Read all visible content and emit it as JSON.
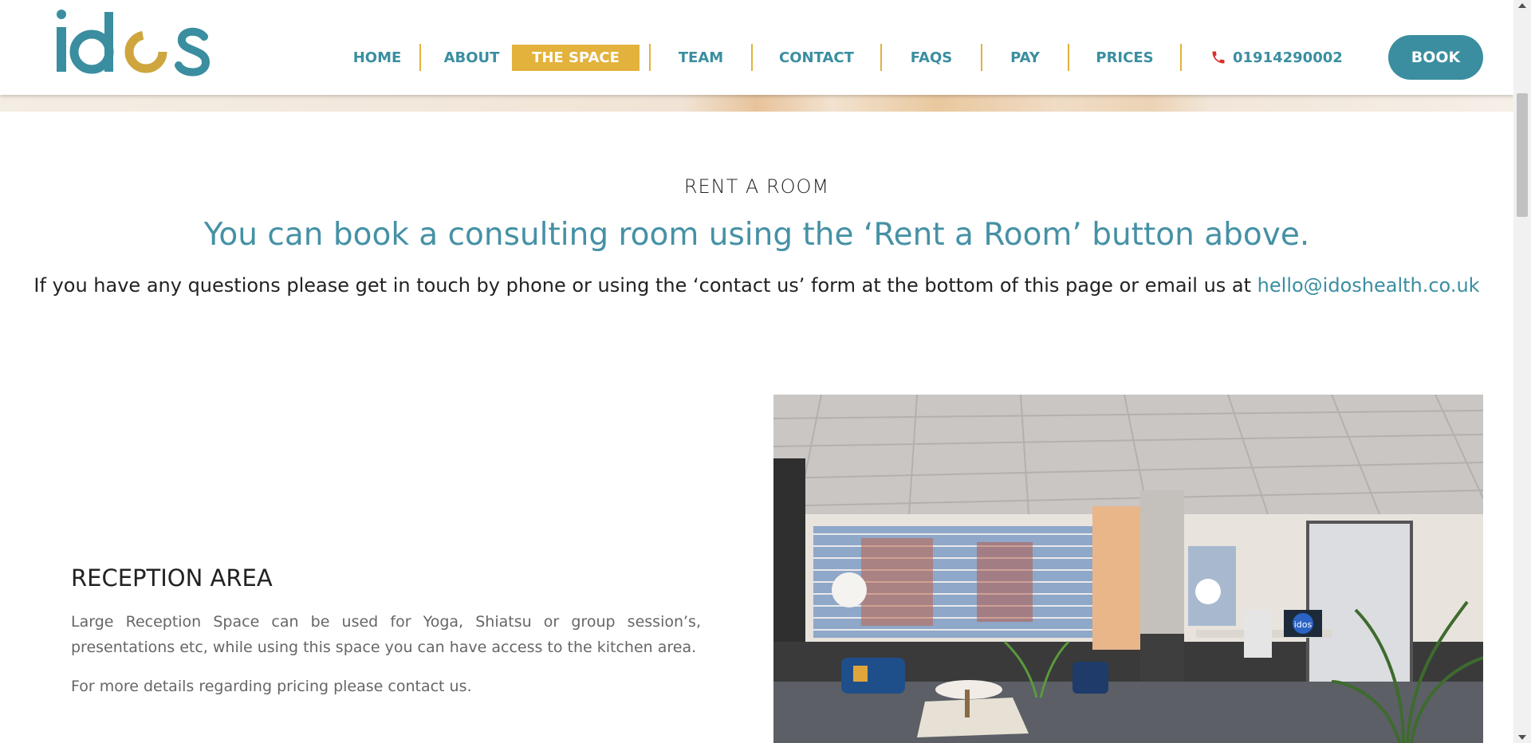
{
  "brand": {
    "logo_text": "idos"
  },
  "nav": {
    "items": [
      {
        "label": "HOME",
        "active": false
      },
      {
        "label": "ABOUT",
        "active": false
      },
      {
        "label": "THE SPACE",
        "active": true
      },
      {
        "label": "TEAM",
        "active": false
      },
      {
        "label": "CONTACT",
        "active": false
      },
      {
        "label": "FAQS",
        "active": false
      },
      {
        "label": "PAY",
        "active": false
      },
      {
        "label": "PRICES",
        "active": false
      }
    ],
    "phone": "01914290002",
    "phone_icon": "phone-icon",
    "book_label": "BOOK"
  },
  "content": {
    "heading": "RENT A ROOM",
    "subheading": "You can book a consulting room using the ‘Rent a Room’ button above.",
    "contact_text": "If you have any questions please get in touch by phone or using the ‘contact us’ form at the bottom of this page or email us at ",
    "email": "hello@idoshealth.co.uk"
  },
  "section": {
    "title": "RECEPTION AREA",
    "description": "Large Reception Space can be used for Yoga, Shiatsu or group session’s, presentations etc, while using this space you can have access to the kitchen area.",
    "note": "For more details regarding pricing please contact us.",
    "photo_monitor_text": "idos"
  },
  "colors": {
    "teal": "#3a8ea0",
    "gold": "#e3b23c",
    "phone_red": "#d9302c"
  }
}
